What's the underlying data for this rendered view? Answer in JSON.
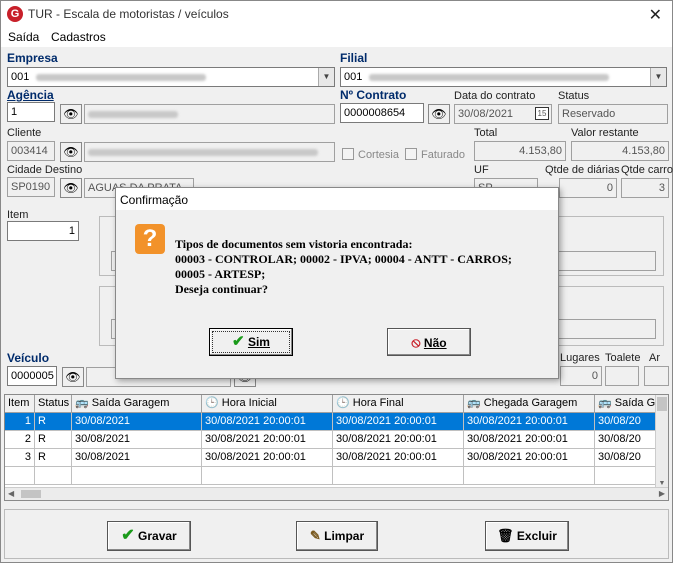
{
  "window": {
    "title": "TUR - Escala de motoristas / veículos",
    "icon_letter": "G"
  },
  "menu": [
    "Saída",
    "Cadastros"
  ],
  "labels": {
    "empresa": "Empresa",
    "filial": "Filial",
    "agencia": "Agência",
    "n_contrato": "Nº Contrato",
    "data_contrato": "Data do contrato",
    "status": "Status",
    "cliente": "Cliente",
    "total": "Total",
    "valor_restante": "Valor restante",
    "cortesia": "Cortesia",
    "faturado": "Faturado",
    "cidade_destino": "Cidade Destino",
    "uf": "UF",
    "qtde_diarias": "Qtde de diárias",
    "qtde_carro": "Qtde carro",
    "item": "Item",
    "veiculo": "Veículo",
    "lugares": "Lugares",
    "toalete": "Toalete",
    "ar": "Ar"
  },
  "fields": {
    "empresa_code": "001",
    "filial_code": "001",
    "agencia_code": "1",
    "n_contrato": "0000008654",
    "data_contrato": "30/08/2021",
    "status": "Reservado",
    "cliente_code": "003414",
    "total": "4.153,80",
    "valor_restante": "4.153,80",
    "cidade_code": "SP0190",
    "cidade_name": "AGUAS DA PRATA",
    "uf": "SP",
    "qtde_diarias": "0",
    "qtde_carro": "3",
    "item": "1",
    "veiculo": "0000005",
    "lugares": "0"
  },
  "table": {
    "headers": [
      "Item",
      "Status",
      "Saída Garagem",
      "Hora Inicial",
      "Hora Final",
      "Chegada Garagem",
      "Saída G"
    ],
    "rows": [
      [
        "1",
        "R",
        "30/08/2021",
        "30/08/2021 20:00:01",
        "30/08/2021 20:00:01",
        "30/08/2021 20:00:01",
        "30/08/20"
      ],
      [
        "2",
        "R",
        "30/08/2021",
        "30/08/2021 20:00:01",
        "30/08/2021 20:00:01",
        "30/08/2021 20:00:01",
        "30/08/20"
      ],
      [
        "3",
        "R",
        "30/08/2021",
        "30/08/2021 20:00:01",
        "30/08/2021 20:00:01",
        "30/08/2021 20:00:01",
        "30/08/20"
      ]
    ]
  },
  "buttons": {
    "gravar": "Gravar",
    "limpar": "Limpar",
    "excluir": "Excluir"
  },
  "dialog": {
    "title": "Confirmação",
    "message_lines": [
      "Tipos de documentos sem vistoria encontrada:",
      "00003 - CONTROLAR; 00002 - IPVA; 00004 - ANTT - CARROS;",
      "00005 - ARTESP;",
      "Deseja continuar?"
    ],
    "yes": "Sim",
    "no": "Não"
  },
  "colors": {
    "selection": "#0078d7",
    "accent_label": "#002b6b",
    "warning_icon": "#f2922a",
    "yes_check": "#1a9a1a",
    "no_icon": "#c8202a"
  }
}
